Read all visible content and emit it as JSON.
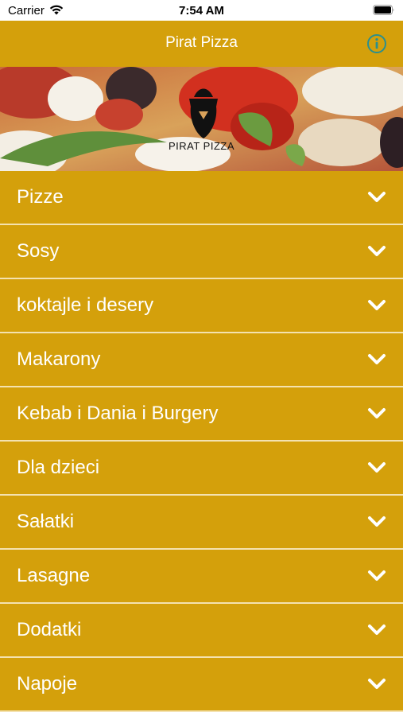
{
  "status_bar": {
    "carrier": "Carrier",
    "time": "7:54 AM"
  },
  "nav": {
    "title": "Pirat Pizza",
    "info_icon": "info-icon"
  },
  "banner": {
    "logo_text": "PIRAT PIZZA"
  },
  "menu": {
    "items": [
      {
        "label": "Pizze"
      },
      {
        "label": "Sosy"
      },
      {
        "label": "koktajle i desery"
      },
      {
        "label": "Makarony"
      },
      {
        "label": "Kebab i Dania i Burgery"
      },
      {
        "label": "Dla dzieci"
      },
      {
        "label": "Sałatki"
      },
      {
        "label": "Lasagne"
      },
      {
        "label": "Dodatki"
      },
      {
        "label": "Napoje"
      }
    ]
  },
  "colors": {
    "accent": "#d4a00b",
    "divider": "#f4e2b0",
    "info_icon": "#2a8f8f"
  }
}
